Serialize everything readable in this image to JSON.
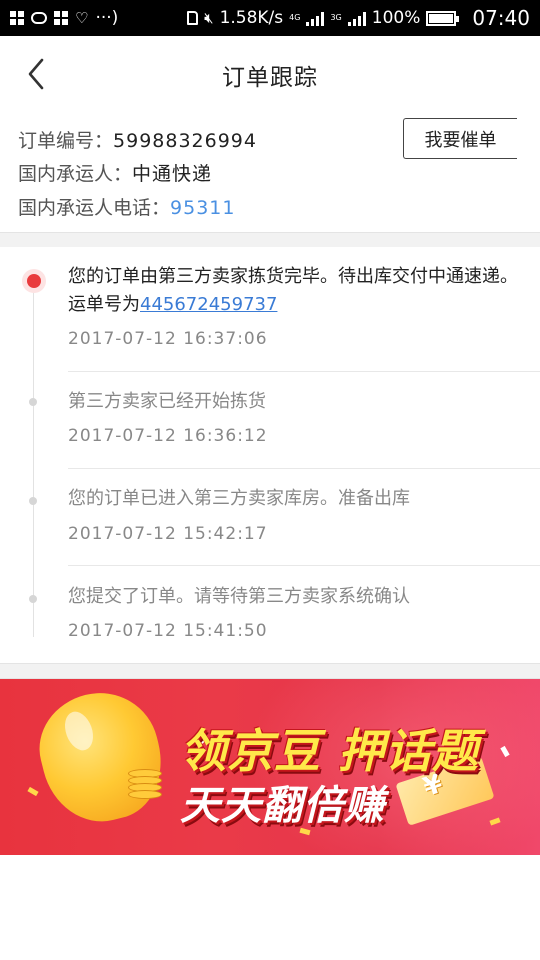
{
  "status_bar": {
    "left_ellipsis": "···)",
    "speed": "1.58K/s",
    "net_tag_1": "4G",
    "net_tag_2": "3G",
    "battery": "100%",
    "time": "07:40",
    "icons": [
      "app-grid-icon",
      "cloud-icon",
      "app-grid-icon",
      "heart-rate-icon",
      "file-icon",
      "mute-icon",
      "signal-icon",
      "signal-icon",
      "battery-icon"
    ]
  },
  "header": {
    "title": "订单跟踪",
    "back_icon": "chevron-left-icon"
  },
  "order": {
    "number_label": "订单编号：",
    "number_value": "59988326994",
    "carrier_label": "国内承运人：",
    "carrier_value": "中通快递",
    "phone_label": "国内承运人电话：",
    "phone_value": "95311",
    "urge_button": "我要催单"
  },
  "timeline": {
    "events": [
      {
        "text": "您的订单由第三方卖家拣货完毕。待出库交付中通速递。运单号为",
        "waybill": "445672459737",
        "time": "2017-07-12 16:37:06"
      },
      {
        "text": "第三方卖家已经开始拣货",
        "time": "2017-07-12 16:36:12"
      },
      {
        "text": "您的订单已进入第三方卖家库房。准备出库",
        "time": "2017-07-12 15:42:17"
      },
      {
        "text": "您提交了订单。请等待第三方卖家系统确认",
        "time": "2017-07-12 15:41:50"
      }
    ]
  },
  "banner": {
    "line1": "领京豆 押话题",
    "line2": "天天翻倍赚",
    "ticket_mark": "¥",
    "colors": {
      "background": "#e8333e",
      "headline": "#ffe94a"
    }
  }
}
